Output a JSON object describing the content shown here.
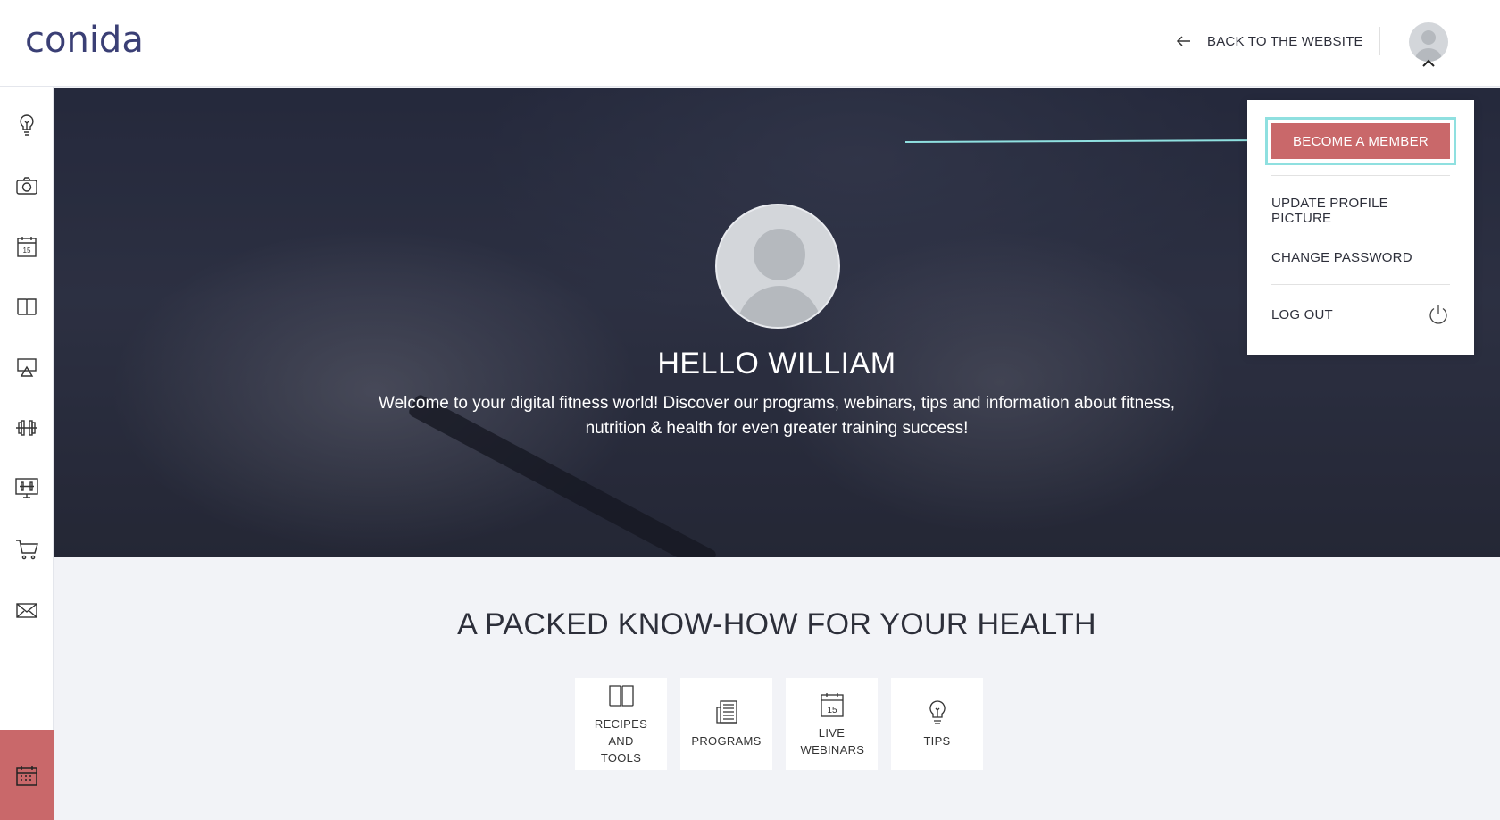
{
  "header": {
    "logo": "conida",
    "back_label": "BACK TO THE WEBSITE"
  },
  "sidebar": {
    "items": [
      {
        "icon": "lightbulb-icon"
      },
      {
        "icon": "camera-icon"
      },
      {
        "icon": "calendar-15-icon",
        "text": "15"
      },
      {
        "icon": "book-icon"
      },
      {
        "icon": "presentation-icon"
      },
      {
        "icon": "dumbbell-icon"
      },
      {
        "icon": "monitor-dumbbell-icon"
      },
      {
        "icon": "cart-icon"
      },
      {
        "icon": "mail-icon"
      }
    ],
    "bottom_icon": "calendar-icon"
  },
  "hero": {
    "title": "HELLO WILLIAM",
    "text": "Welcome to your digital fitness world! Discover our programs, webinars, tips and information about fitness, nutrition & health for even greater training success!"
  },
  "dropdown": {
    "member_label": "BECOME A MEMBER",
    "items": [
      {
        "label": "UPDATE PROFILE PICTURE"
      },
      {
        "label": "CHANGE PASSWORD"
      },
      {
        "label": "LOG OUT"
      }
    ]
  },
  "section": {
    "title": "A PACKED KNOW-HOW FOR YOUR HEALTH",
    "cards": [
      {
        "label": "RECIPES AND TOOLS",
        "icon": "book-icon"
      },
      {
        "label": "PROGRAMS",
        "icon": "newspaper-icon"
      },
      {
        "label": "LIVE WEBINARS",
        "icon": "calendar-15-icon",
        "text": "15"
      },
      {
        "label": "TIPS",
        "icon": "lightbulb-icon"
      }
    ]
  },
  "colors": {
    "accent": "#c9686a",
    "highlight": "#8fe0e0",
    "logo": "#3a3f75"
  }
}
